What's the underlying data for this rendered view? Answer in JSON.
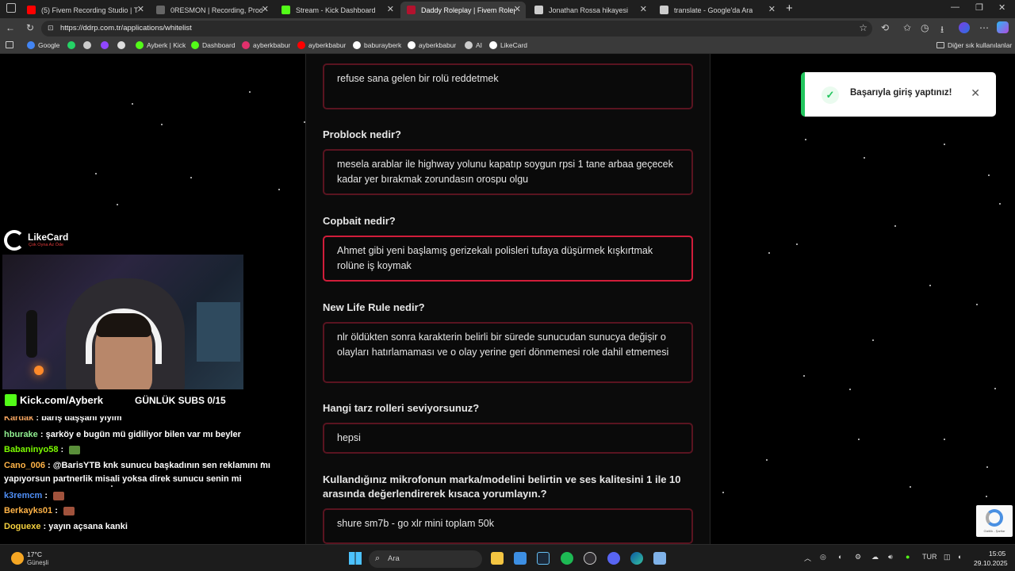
{
  "browser": {
    "tabs": [
      {
        "title": "(5) Fivem Recording Studio | Take",
        "favicon_color": "#ff0000"
      },
      {
        "title": "0RESMON | Recording, Producer,",
        "favicon_color": "#666666"
      },
      {
        "title": "Stream - Kick Dashboard",
        "favicon_color": "#53fc18"
      },
      {
        "title": "Daddy Roleplay | Fivem Roleplay",
        "favicon_color": "#b3122e",
        "active": true
      },
      {
        "title": "Jonathan Rossa hikayesi",
        "favicon_color": "#cccccc"
      },
      {
        "title": "translate - Google'da Ara",
        "favicon_color": "#cccccc"
      }
    ],
    "url": "https://ddrp.com.tr/applications/whitelist",
    "bookmarks": [
      {
        "label": "Google",
        "color": "#4285f4"
      },
      {
        "label": "",
        "color": "#25d366"
      },
      {
        "label": "",
        "color": "#cccccc"
      },
      {
        "label": "",
        "color": "#9146ff"
      },
      {
        "label": "",
        "color": "#dddddd"
      },
      {
        "label": "Ayberk | Kick",
        "color": "#53fc18"
      },
      {
        "label": "Dashboard",
        "color": "#53fc18"
      },
      {
        "label": "ayberkbabur",
        "color": "#e1306c"
      },
      {
        "label": "ayberkbabur",
        "color": "#ff0000"
      },
      {
        "label": "baburayberk",
        "color": "#ffffff"
      },
      {
        "label": "ayberkbabur",
        "color": "#ffffff"
      },
      {
        "label": "AI",
        "color": "#cccccc"
      },
      {
        "label": "LikeCard",
        "color": "#ffffff"
      }
    ],
    "bookmarks_other": "Diğer sık kullanılanlar"
  },
  "form": {
    "items": [
      {
        "question": "",
        "answer": "refuse sana gelen bir rolü reddetmek"
      },
      {
        "question": "Problock nedir?",
        "answer": "mesela arablar ile highway yolunu kapatıp soygun rpsi 1 tane arbaa geçecek kadar yer bırakmak zorundasın orospu olgu"
      },
      {
        "question": "Copbait nedir?",
        "answer": "Ahmet gibi yeni başlamış gerizekalı polisleri tufaya düşürmek kışkırtmak rolüne iş koymak",
        "focused": true
      },
      {
        "question": "New Life Rule nedir?",
        "answer": "nlr öldükten sonra karakterin belirli bir sürede sunucudan sunucya değişir o olayları hatırlamaması ve o olay yerine geri dönmemesi role dahil etmemesi"
      },
      {
        "question": "Hangi tarz rolleri seviyorsunuz?",
        "answer": "hepsi"
      },
      {
        "question": "Kullandığınız mikrofonun marka/modelini belirtin ve ses kalitesini 1 ile 10 arasında değerlendirerek kısaca yorumlayın.?",
        "answer": "shure sm7b - go xlr mini toplam 50k"
      }
    ]
  },
  "toast": {
    "message": "Başarıyla giriş yaptınız!",
    "accent": "#22c55e"
  },
  "stream_overlay": {
    "logo_name": "LikeCard",
    "logo_tagline": "Çok Oyna Az Öde",
    "kick_link": "Kick.com/Ayberk",
    "subs_goal": "GÜNLÜK SUBS 0/15",
    "chat": [
      {
        "user": "Kardak",
        "message": "barış daşşanı yiyim",
        "color": "#f4a460"
      },
      {
        "user": "hburake",
        "message": "şarköy e bugün mü gidiliyor bilen var mı beyler",
        "color": "#90ee90"
      },
      {
        "user": "Babaninyo58",
        "message": "",
        "color": "#7cfc00",
        "emote": true
      },
      {
        "user": "Cano_006",
        "message": "@BarisYTB knk sunucu başkadının sen reklamını mı yapıyorsun partnerlik misali yoksa direk sunucu senin mi",
        "color": "#ffb347"
      },
      {
        "user": "k3remcm",
        "message": "",
        "color": "#4f8ff7",
        "emote": true
      },
      {
        "user": "Berkayks01",
        "message": "",
        "color": "#ffb347",
        "emote": true
      },
      {
        "user": "Doguexe",
        "message": "yayın açsana kanki",
        "color": "#f4d03f"
      }
    ]
  },
  "taskbar": {
    "weather_temp": "17°C",
    "weather_desc": "Güneşli",
    "search_placeholder": "Ara",
    "language": "TUR",
    "time": "15:05",
    "date": "29.10.2025"
  },
  "recaptcha": {
    "label": "Gizlilik - Şartlar"
  }
}
